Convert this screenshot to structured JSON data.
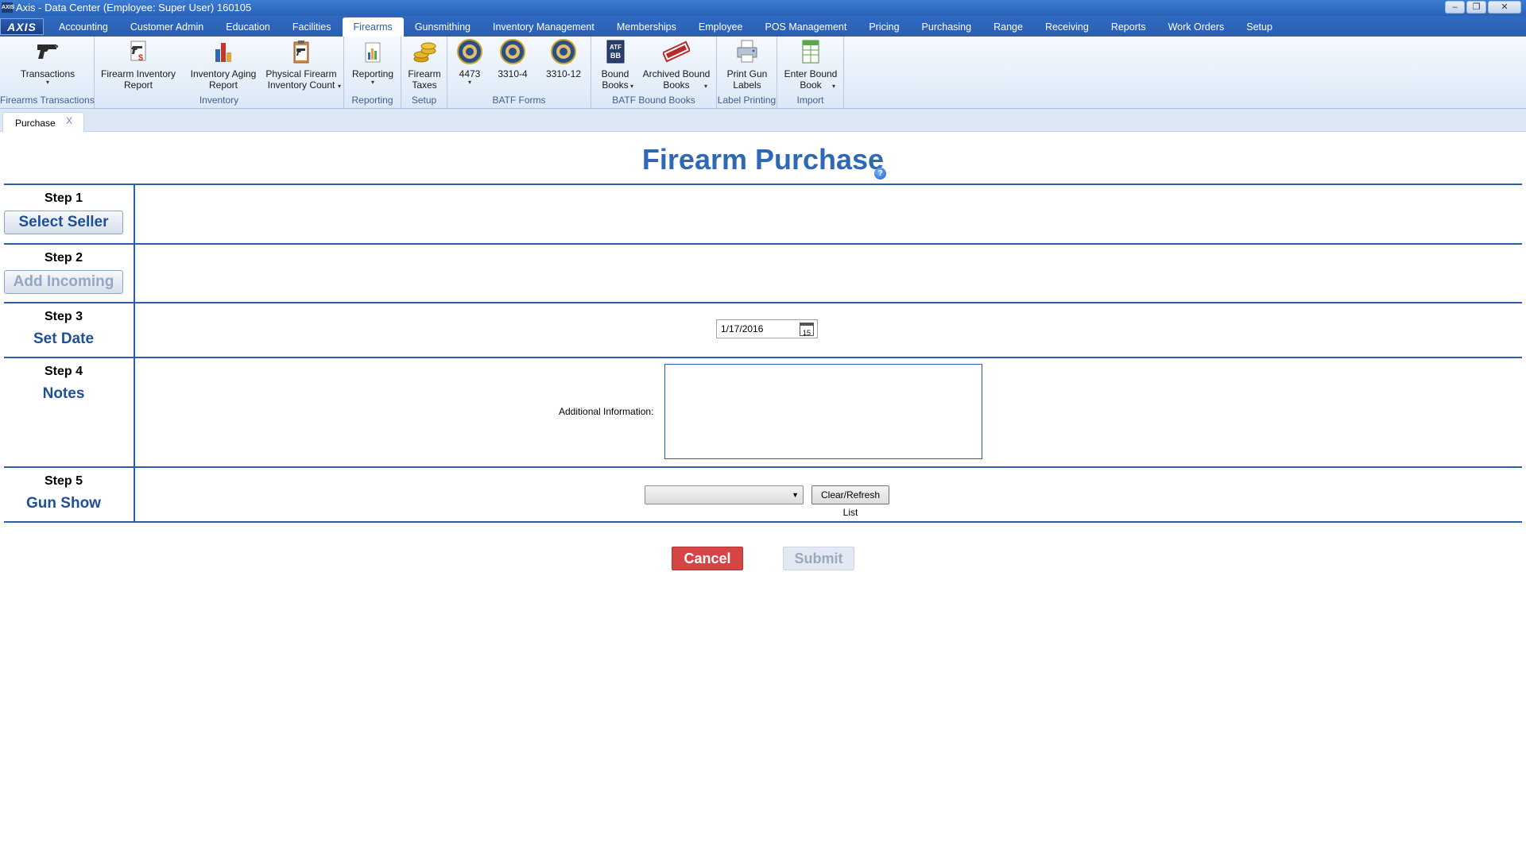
{
  "window": {
    "app_icon": "AXIS",
    "title": "Axis - Data Center  (Employee: Super User) 160105",
    "controls": [
      "minimize-icon",
      "restore-icon",
      "close-icon"
    ]
  },
  "menu": {
    "logo": "AXIS",
    "tabs": [
      "Accounting",
      "Customer Admin",
      "Education",
      "Facilities",
      "Firearms",
      "Gunsmithing",
      "Inventory Management",
      "Memberships",
      "Employee",
      "POS Management",
      "Pricing",
      "Purchasing",
      "Range",
      "Receiving",
      "Reports",
      "Work Orders",
      "Setup"
    ],
    "active_tab": "Firearms"
  },
  "ribbon": {
    "groups": [
      {
        "label": "Firearms Transactions",
        "buttons": [
          {
            "label": "Transactions",
            "icon": "pistol-icon",
            "dropdown": true
          }
        ]
      },
      {
        "label": "Inventory",
        "buttons": [
          {
            "label": "Firearm Inventory\nReport",
            "icon": "inventory-report-icon"
          },
          {
            "label": "Inventory Aging\nReport",
            "icon": "bar-chart-icon"
          },
          {
            "label": "Physical Firearm\nInventory Count",
            "icon": "clipboard-pistol-icon",
            "dropdown": true
          }
        ]
      },
      {
        "label": "Reporting",
        "buttons": [
          {
            "label": "Reporting",
            "icon": "report-chart-icon",
            "dropdown": true
          }
        ]
      },
      {
        "label": "Setup",
        "buttons": [
          {
            "label": "Firearm\nTaxes",
            "icon": "coins-icon"
          }
        ]
      },
      {
        "label": "BATF Forms",
        "buttons": [
          {
            "label": "4473",
            "icon": "seal-icon",
            "dropdown": true
          },
          {
            "label": "3310-4",
            "icon": "seal-icon"
          },
          {
            "label": "3310-12",
            "icon": "seal-icon"
          }
        ]
      },
      {
        "label": "BATF Bound Books",
        "buttons": [
          {
            "label": "Bound\nBooks",
            "icon": "bound-book-icon",
            "dropdown": true
          },
          {
            "label": "Archived Bound\nBooks",
            "icon": "archived-stamp-icon",
            "dropdown": true
          }
        ]
      },
      {
        "label": "Label Printing",
        "buttons": [
          {
            "label": "Print Gun\nLabels",
            "icon": "printer-icon"
          }
        ]
      },
      {
        "label": "Import",
        "buttons": [
          {
            "label": "Enter Bound\nBook",
            "icon": "spreadsheet-icon",
            "dropdown": true
          }
        ]
      }
    ]
  },
  "doc_tab": {
    "label": "Purchase",
    "close": "X"
  },
  "page": {
    "title": "Firearm Purchase",
    "help_icon": "?",
    "steps": [
      {
        "num": "Step 1",
        "label": "Select Seller",
        "kind": "button"
      },
      {
        "num": "Step 2",
        "label": "Add Incoming",
        "kind": "button-disabled"
      },
      {
        "num": "Step 3",
        "label": "Set Date",
        "kind": "text"
      },
      {
        "num": "Step 4",
        "label": "Notes",
        "kind": "text"
      },
      {
        "num": "Step 5",
        "label": "Gun Show",
        "kind": "text"
      }
    ],
    "date_value": "1/17/2016",
    "calendar_day": "15",
    "notes_label": "Additional Information:",
    "notes_value": "",
    "gunshow_value": "",
    "refresh_label": "Clear/Refresh List",
    "cancel_label": "Cancel",
    "submit_label": "Submit"
  },
  "colors": {
    "title_blue": "#2f69b5",
    "rule_blue": "#2a5fb0",
    "cancel_red": "#d64545"
  }
}
